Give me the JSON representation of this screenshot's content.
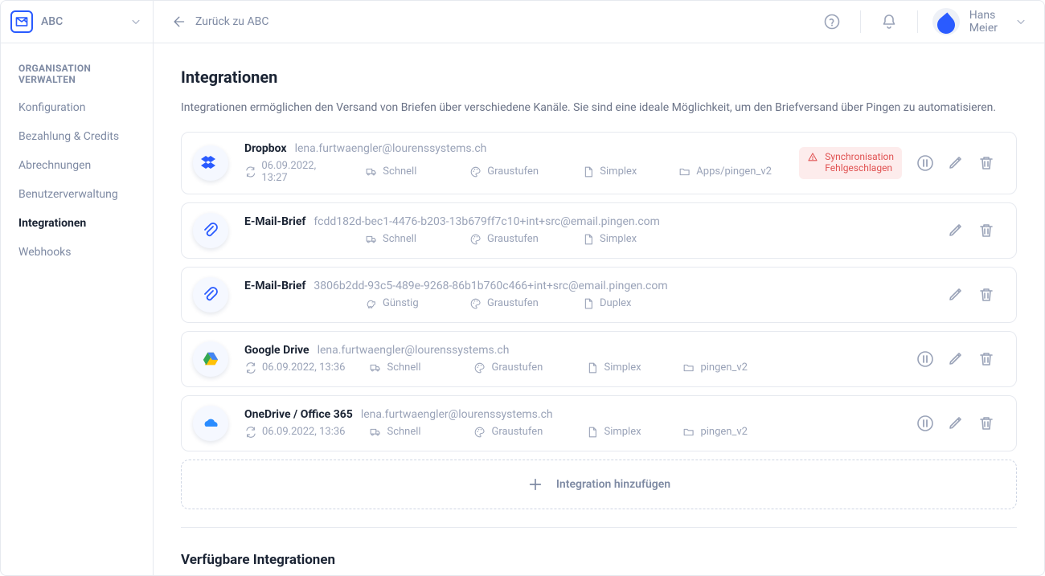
{
  "org": {
    "name": "ABC"
  },
  "user": {
    "first": "Hans",
    "last": "Meier"
  },
  "back_label": "Zurück zu ABC",
  "sidebar": {
    "section": "ORGANISATION\nVERWALTEN",
    "items": [
      {
        "label": "Konfiguration"
      },
      {
        "label": "Bezahlung & Credits"
      },
      {
        "label": "Abrechnungen"
      },
      {
        "label": "Benutzerverwaltung"
      },
      {
        "label": "Integrationen"
      },
      {
        "label": "Webhooks"
      }
    ],
    "active_index": 4
  },
  "page": {
    "title": "Integrationen",
    "desc": "Integrationen ermöglichen den Versand von Briefen über verschiedene Kanäle. Sie sind eine ideale Möglichkeit, um den Briefversand über Pingen zu automatisieren.",
    "add_label": "Integration hinzufügen",
    "available_title": "Verfügbare Integrationen"
  },
  "status_error": "Synchronisation\nFehlgeschlagen",
  "integrations": [
    {
      "type": "dropbox",
      "title": "Dropbox",
      "sub": "lena.furtwaengler@lourenssystems.ch",
      "sync": "06.09.2022, 13:27",
      "speed": "Schnell",
      "color": "Graustufen",
      "plex": "Simplex",
      "folder": "Apps/pingen_v2",
      "has_sync": true,
      "has_folder": true,
      "has_pause": true,
      "error": true
    },
    {
      "type": "email",
      "title": "E-Mail-Brief",
      "sub": "fcdd182d-bec1-4476-b203-13b679ff7c10+int+src@email.pingen.com",
      "speed": "Schnell",
      "color": "Graustufen",
      "plex": "Simplex",
      "has_sync": false,
      "has_folder": false,
      "has_pause": false
    },
    {
      "type": "email",
      "title": "E-Mail-Brief",
      "sub": "3806b2dd-93c5-489e-9268-86b1b760c466+int+src@email.pingen.com",
      "speed": "Günstig",
      "color": "Graustufen",
      "plex": "Duplex",
      "has_sync": false,
      "has_folder": false,
      "has_pause": false,
      "speed_cheap": true
    },
    {
      "type": "gdrive",
      "title": "Google Drive",
      "sub": "lena.furtwaengler@lourenssystems.ch",
      "sync": "06.09.2022, 13:36",
      "speed": "Schnell",
      "color": "Graustufen",
      "plex": "Simplex",
      "folder": "pingen_v2",
      "has_sync": true,
      "has_folder": true,
      "has_pause": true
    },
    {
      "type": "onedrive",
      "title": "OneDrive / Office 365",
      "sub": "lena.furtwaengler@lourenssystems.ch",
      "sync": "06.09.2022, 13:36",
      "speed": "Schnell",
      "color": "Graustufen",
      "plex": "Simplex",
      "folder": "pingen_v2",
      "has_sync": true,
      "has_folder": true,
      "has_pause": true
    }
  ]
}
